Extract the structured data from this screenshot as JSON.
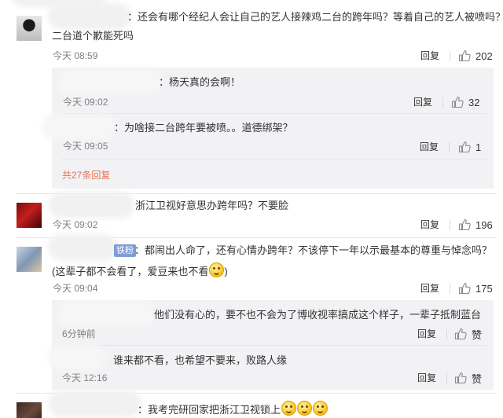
{
  "header_partial": "ππ… ·…",
  "comments": [
    {
      "text_line1": "：还会有哪个经纪人会让自己的艺人接辣鸡二台的跨年吗？等着自己的艺人被喷吗？",
      "text_line2": "二台道个歉能死吗",
      "time": "今天 08:59",
      "reply_label": "回复",
      "likes": "202",
      "replies": [
        {
          "text": "：杨天真的会啊！",
          "time": "今天 09:02",
          "reply_label": "回复",
          "likes": "32"
        },
        {
          "text": "：为啥接二台跨年要被喷。。道德绑架？",
          "time": "今天 09:05",
          "reply_label": "回复",
          "likes": "1"
        }
      ],
      "more_replies": "共27条回复"
    },
    {
      "text_line1": "浙江卫视好意思办跨年吗？不要脸",
      "time": "今天 09:02",
      "reply_label": "回复",
      "likes": "196"
    },
    {
      "badge": "铁粉",
      "text_line1": "：都闹出人命了，还有心情办跨年？不该停下一年以示最基本的尊重与悼念吗？",
      "text_line2": "(这辈子都不会看了，爱豆来也不看",
      "text_line2_end": ")",
      "time": "今天 09:04",
      "reply_label": "回复",
      "likes": "175",
      "replies": [
        {
          "text": "他们没有心的，要不也不会为了博收视率搞成这个样子，一辈子抵制蓝台",
          "time": "6分钟前",
          "reply_label": "回复",
          "likes": "赞"
        },
        {
          "text": "谁来都不看，也希望不要来，败路人缘",
          "time": "今天 12:16",
          "reply_label": "回复",
          "likes": "赞"
        }
      ]
    },
    {
      "text_line1": "：我考完研回家把浙江卫视锁上"
    }
  ],
  "icons": {
    "like": "thumbs-up-icon",
    "emoji": "smile-emoji-icon"
  },
  "colors": {
    "more_link": "#eb7350",
    "badge": "#7f9bd6",
    "subbox": "#f2f2f5"
  }
}
